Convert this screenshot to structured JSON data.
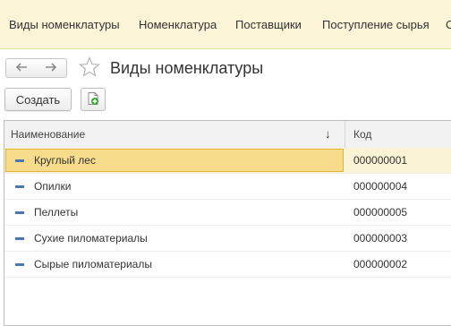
{
  "topnav": {
    "items": [
      "Виды номенклатуры",
      "Номенклатура",
      "Поставщики",
      "Поступление сырья",
      "С"
    ]
  },
  "toolbar": {
    "back_icon": "arrow-left-icon",
    "forward_icon": "arrow-right-icon",
    "favorite_icon": "star-icon",
    "create_label": "Создать",
    "add_copy_icon": "add-copy-icon"
  },
  "page": {
    "title": "Виды номенклатуры"
  },
  "table": {
    "columns": [
      "Наименование",
      "Код"
    ],
    "sort_indicator": "↓",
    "selected_row": 0,
    "rows": [
      {
        "name": "Круглый лес",
        "code": "000000001"
      },
      {
        "name": "Опилки",
        "code": "000000004"
      },
      {
        "name": "Пеллеты",
        "code": "000000005"
      },
      {
        "name": "Сухие пиломатериалы",
        "code": "000000003"
      },
      {
        "name": "Сырые пиломатериалы",
        "code": "000000002"
      }
    ]
  },
  "colors": {
    "nav_background": "#fbf4d7",
    "selected_row": "#f7dd8b",
    "selected_border": "#e1b23a",
    "row_marker": "#4a78b0",
    "add_icon_green": "#3aa335"
  }
}
